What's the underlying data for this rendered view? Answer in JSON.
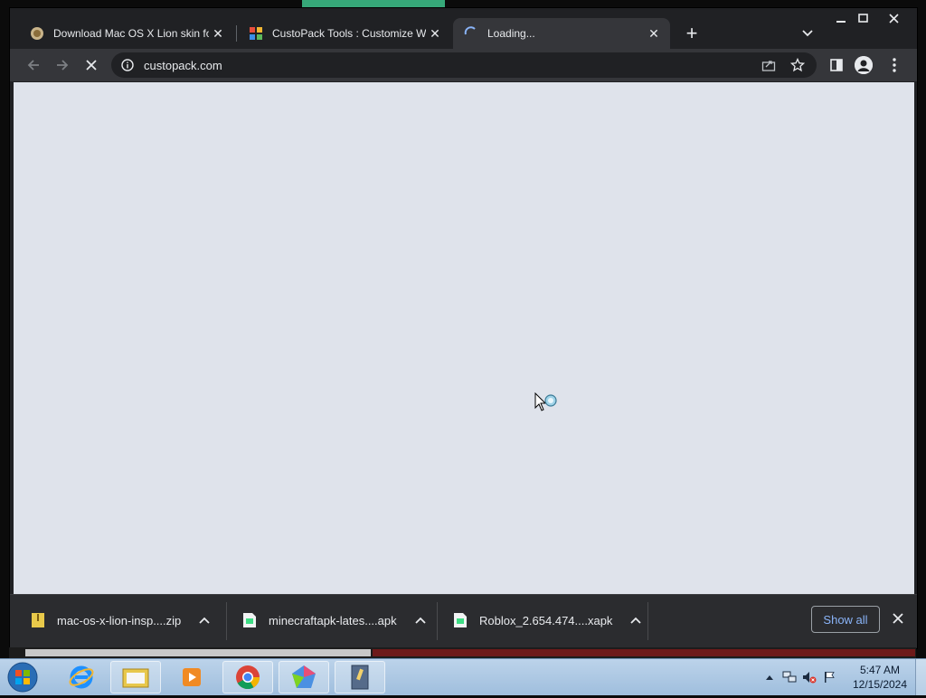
{
  "browser": {
    "tabs": [
      {
        "title": "Download Mac OS X Lion skin fo",
        "close_glyph": "✕",
        "active": false,
        "favicon": "mac-lion-favicon"
      },
      {
        "title": "CustoPack Tools : Customize Win",
        "close_glyph": "✕",
        "active": false,
        "favicon": "custopack-favicon"
      },
      {
        "title": "Loading...",
        "close_glyph": "✕",
        "active": true,
        "favicon": "loading-spinner-icon"
      }
    ],
    "new_tab_glyph": "+",
    "window_controls": {
      "minimize": "—",
      "maximize": "☐",
      "close": "✕"
    },
    "toolbar": {
      "url": "custopack.com",
      "back_glyph": "←",
      "forward_glyph": "→",
      "stop_glyph": "✕"
    }
  },
  "downloads": {
    "items": [
      {
        "name": "mac-os-x-lion-insp....zip",
        "icon": "zip-file-icon"
      },
      {
        "name": "minecraftapk-lates....apk",
        "icon": "apk-file-icon"
      },
      {
        "name": "Roblox_2.654.474....xapk",
        "icon": "xapk-file-icon"
      }
    ],
    "show_all": "Show all",
    "close_glyph": "✕"
  },
  "taskbar": {
    "apps": [
      "internet-explorer-icon",
      "windows-explorer-icon",
      "media-player-icon",
      "chrome-icon",
      "app-launcher-icon",
      "document-app-icon"
    ],
    "clock": {
      "time": "5:47 AM",
      "date": "12/15/2024"
    }
  },
  "colors": {
    "tabstrip": "#202124",
    "toolbar": "#35363a",
    "content_bg": "#dfe3eb",
    "link": "#8ab4f8",
    "taskbar": "#bcd3ea"
  }
}
